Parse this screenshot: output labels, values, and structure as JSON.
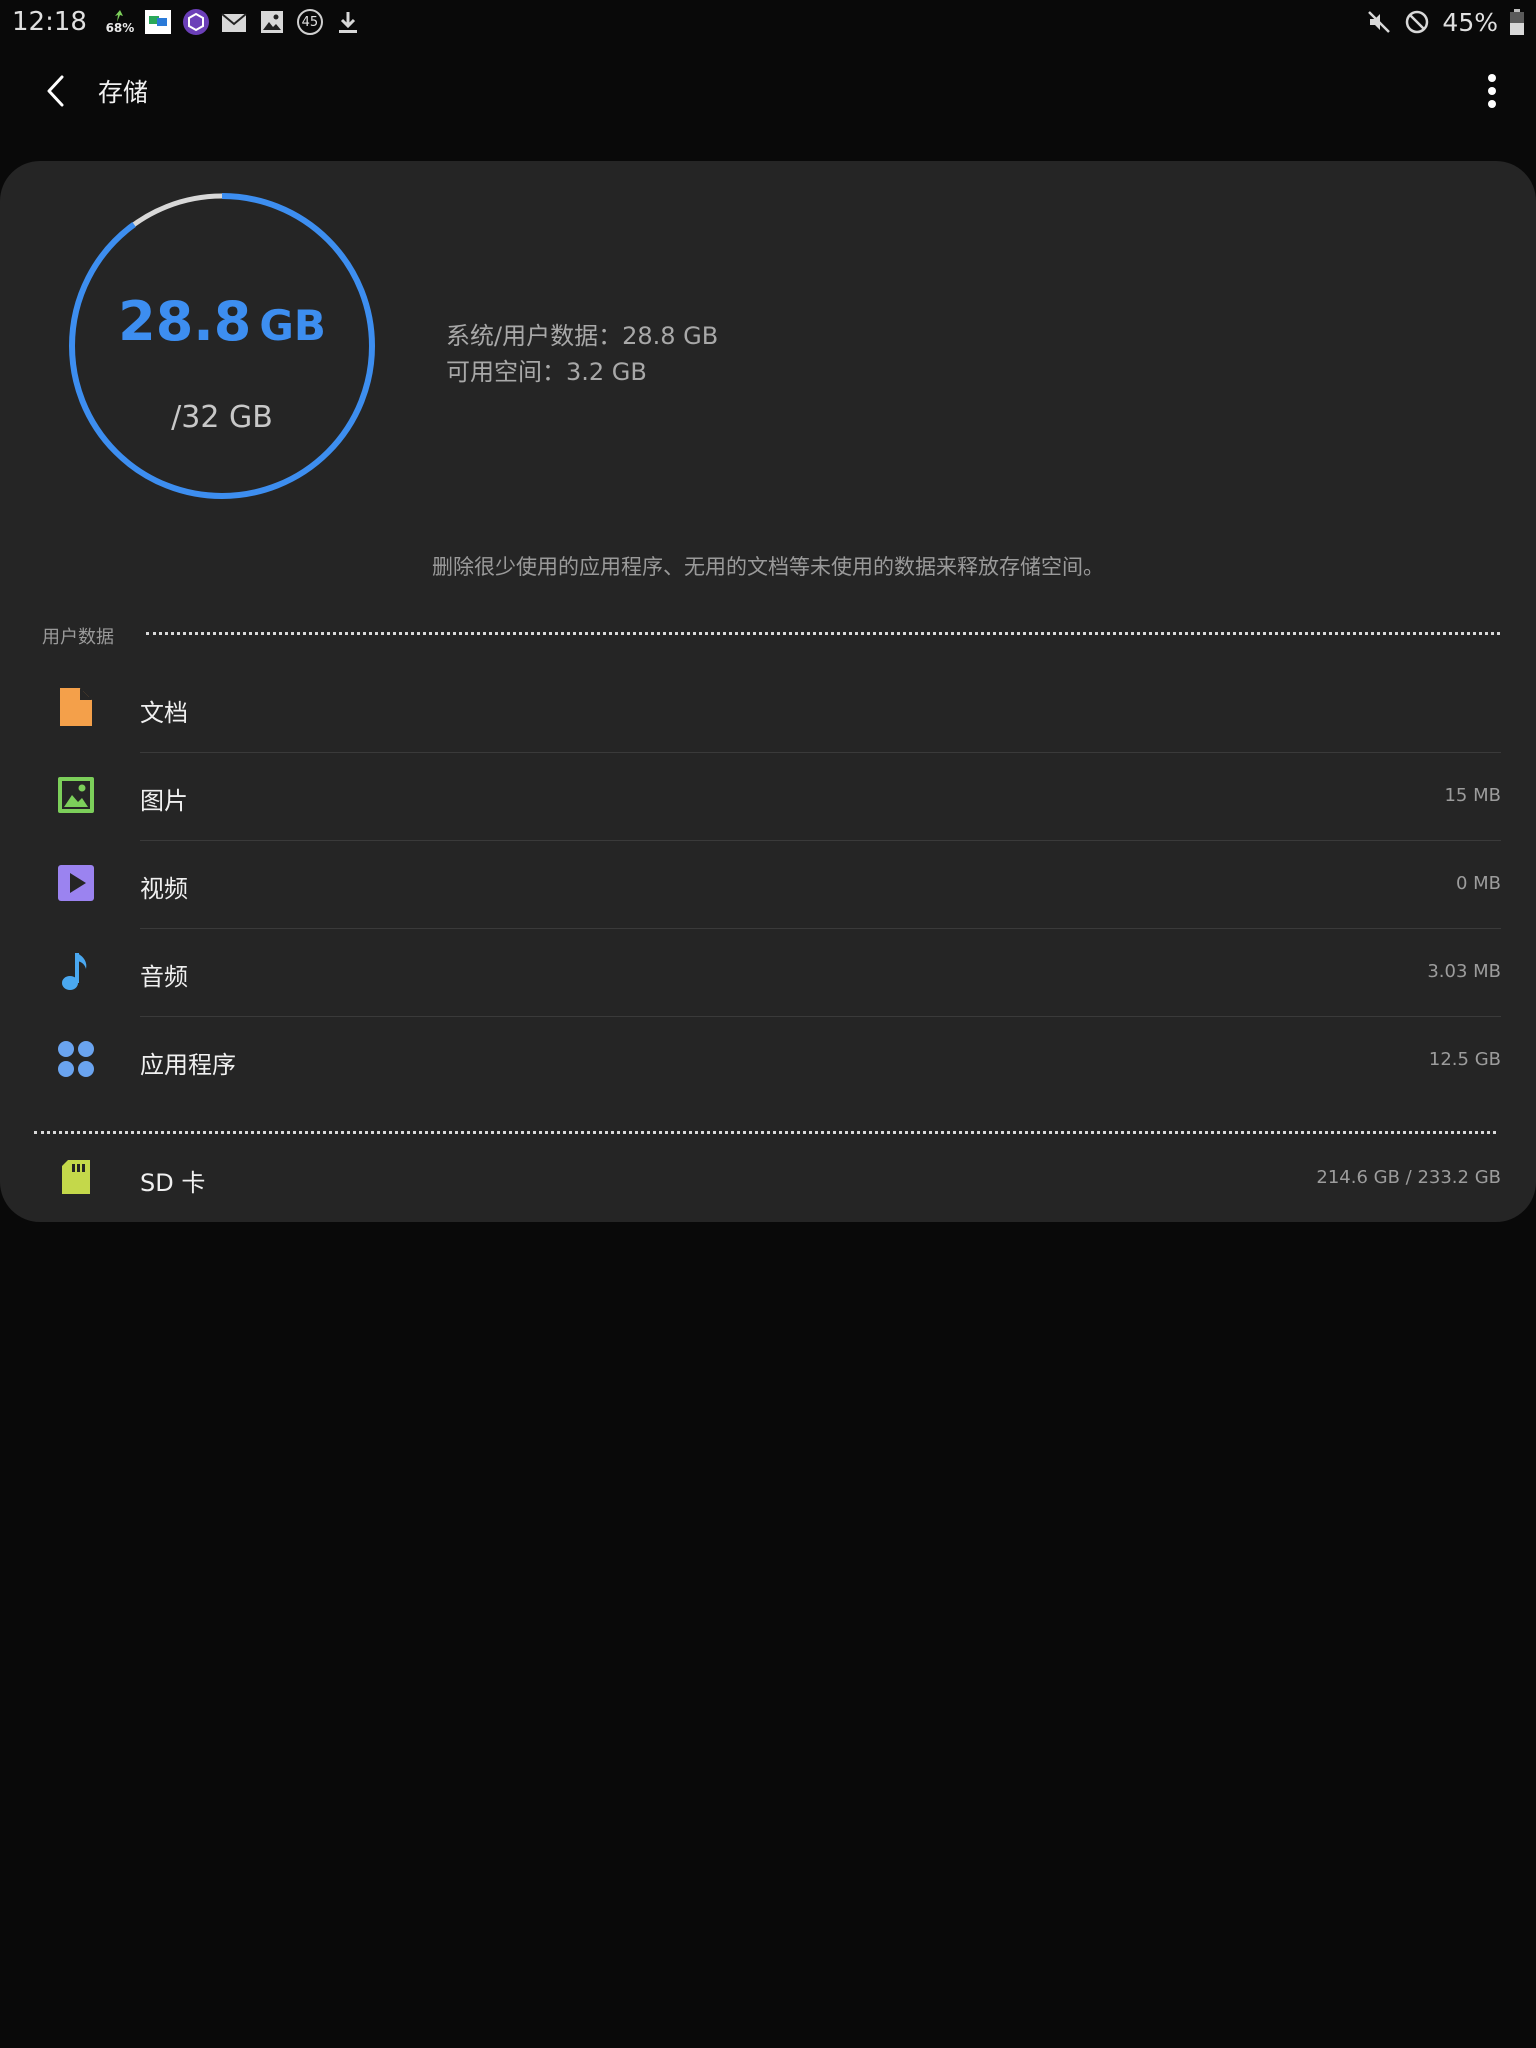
{
  "status_bar": {
    "time": "12:18",
    "battery_percent": "45%",
    "data_saver_percent": "68%",
    "notification_count": "45",
    "icons": [
      "data-usage-icon",
      "app-notification-icon",
      "vpn-icon",
      "mail-icon",
      "gallery-icon",
      "badge-45-icon",
      "download-icon",
      "mute-icon",
      "do-not-disturb-icon",
      "battery-icon"
    ]
  },
  "app_bar": {
    "title": "存储"
  },
  "storage": {
    "used_value": "28.8",
    "used_unit": "GB",
    "total_label": "/32 GB",
    "used_fraction": 0.9,
    "system_user_data": "系统/用户数据：28.8 GB",
    "available_space": "可用空间：3.2 GB",
    "hint": "删除很少使用的应用程序、无用的文档等未使用的数据来释放存储空间。"
  },
  "user_data_section": {
    "label": "用户数据",
    "items": [
      {
        "label": "文档",
        "value": "",
        "icon": "document-icon",
        "color": "#f4a04a"
      },
      {
        "label": "图片",
        "value": "15 MB",
        "icon": "image-icon",
        "color": "#7ccf5a"
      },
      {
        "label": "视频",
        "value": "0 MB",
        "icon": "video-icon",
        "color": "#9b83f0"
      },
      {
        "label": "音频",
        "value": "3.03 MB",
        "icon": "music-note-icon",
        "color": "#4aa8f0"
      },
      {
        "label": "应用程序",
        "value": "12.5 GB",
        "icon": "apps-icon",
        "color": "#6aa4f0"
      }
    ]
  },
  "sd_card": {
    "label": "SD 卡",
    "value": "214.6 GB / 233.2 GB",
    "icon": "sd-card-icon",
    "color": "#c4d84a"
  },
  "colors": {
    "accent": "#3d8ef0",
    "ring_track": "#d8d8d8",
    "card_bg": "#252525",
    "page_bg": "#090909"
  }
}
